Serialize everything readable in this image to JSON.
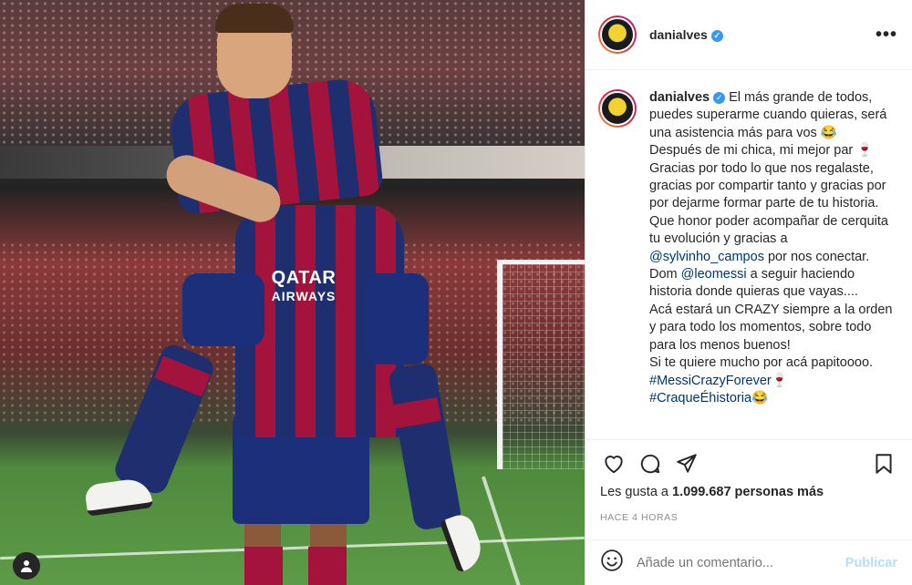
{
  "post": {
    "username": "danialves",
    "more_label": "•••",
    "verified_mark": "✓"
  },
  "photo": {
    "sponsor_top": "QATAR",
    "sponsor_bottom": "AIRWAYS",
    "badge_icon": "user-icon"
  },
  "caption": {
    "username": "danialves",
    "line1": "El más grande de todos, puedes superarme cuando quieras, será una asistencia más para vos 😂",
    "line2": "Después de mi chica, mi mejor par 🍷",
    "line3": "Gracias por todo lo que nos regalaste, gracias por compartir tanto y gracias por por dejarme formar parte de tu historia.",
    "line4a": "Que honor poder acompañar de cerquita tu evolución y gracias a",
    "mention1": "@sylvinho_campos",
    "line4b": "por nos conectar.",
    "line5a": "Dom",
    "mention2": "@leomessi",
    "line5b": "a seguir haciendo historia donde quieras que vayas....",
    "line6": "Acá estará un CRAZY siempre a la orden y para todo los momentos, sobre todo para los menos buenos!",
    "line7": "Si te quiere mucho por acá papitoooo.",
    "hashtag1": "#MessiCrazyForever🍷",
    "hashtag2": "#CraqueÉhistoria😂"
  },
  "actions": {
    "icons": [
      "heart-icon",
      "comment-icon",
      "share-icon",
      "bookmark-icon"
    ],
    "likes_prefix": "Les gusta a",
    "likes_count": "1.099.687 personas más",
    "timestamp": "HACE 4 HORAS"
  },
  "comment": {
    "placeholder": "Añade un comentario...",
    "publish_label": "Publicar"
  },
  "colors": {
    "link": "#00376b",
    "verified": "#3897f0",
    "publish_disabled": "#b2dffc",
    "muted": "#8e8e8e"
  }
}
